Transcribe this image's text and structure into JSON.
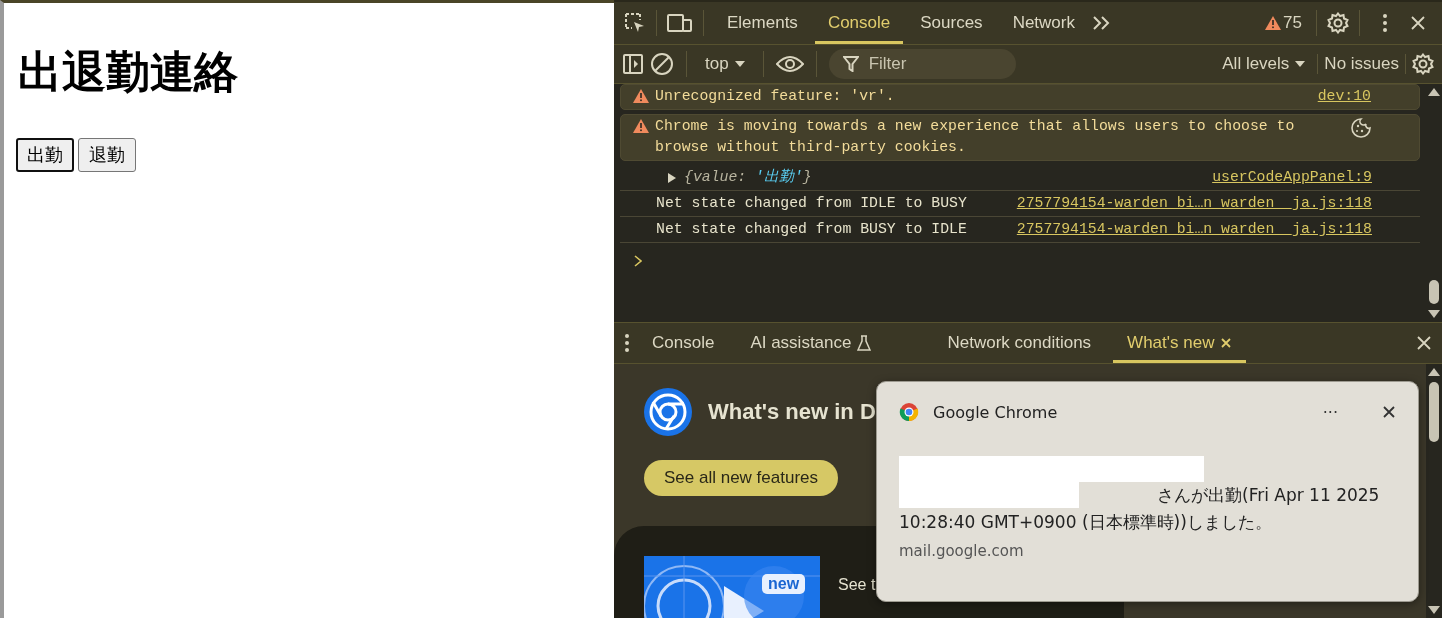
{
  "page": {
    "heading": "出退勤連絡",
    "buttons": [
      {
        "label": "出勤",
        "focused": true
      },
      {
        "label": "退勤",
        "focused": false
      }
    ]
  },
  "devtools": {
    "tabs": [
      {
        "label": "Elements",
        "selected": false
      },
      {
        "label": "Console",
        "selected": true
      },
      {
        "label": "Sources",
        "selected": false
      },
      {
        "label": "Network",
        "selected": false
      }
    ],
    "warning_count": "75",
    "console_toolbar": {
      "context": "top",
      "filter_placeholder": "Filter",
      "levels": "All levels",
      "issues": "No issues"
    },
    "messages": [
      {
        "kind": "warning",
        "text": "Unrecognized feature: 'vr'.",
        "source": "dev:10"
      },
      {
        "kind": "warning",
        "text": "Chrome is moving towards a new experience that allows users to choose to browse without third-party cookies.",
        "cookie": true
      },
      {
        "kind": "object",
        "parts": [
          {
            "kind": "key",
            "text": "{value: "
          },
          {
            "kind": "string",
            "text": "'出勤'"
          },
          {
            "kind": "key",
            "text": "}"
          }
        ],
        "source": "userCodeAppPanel:9"
      },
      {
        "kind": "log",
        "text": "Net state changed from IDLE to BUSY",
        "source": "2757794154-warden_bi…n_warden__ja.js:118"
      },
      {
        "kind": "log",
        "text": "Net state changed from BUSY to IDLE",
        "source": "2757794154-warden_bi…n_warden__ja.js:118"
      }
    ],
    "drawer": {
      "tabs": [
        {
          "label": "Console",
          "selected": false,
          "kind": "plain"
        },
        {
          "label": "AI assistance",
          "selected": false,
          "kind": "flask"
        },
        {
          "label": "Network conditions",
          "selected": false,
          "kind": "plain"
        },
        {
          "label": "What's new",
          "selected": true,
          "kind": "closable"
        }
      ]
    },
    "whats_new": {
      "title": "What's new in D",
      "button": "See all new features",
      "card": {
        "badge": "new",
        "text": "See t"
      }
    }
  },
  "notification": {
    "app": "Google Chrome",
    "menu": "···",
    "lines": [
      "さんが出勤(Fri Apr 11 2025",
      "10:28:40 GMT+0900 (日本標準時))しました。"
    ],
    "origin": "mail.google.com"
  }
}
